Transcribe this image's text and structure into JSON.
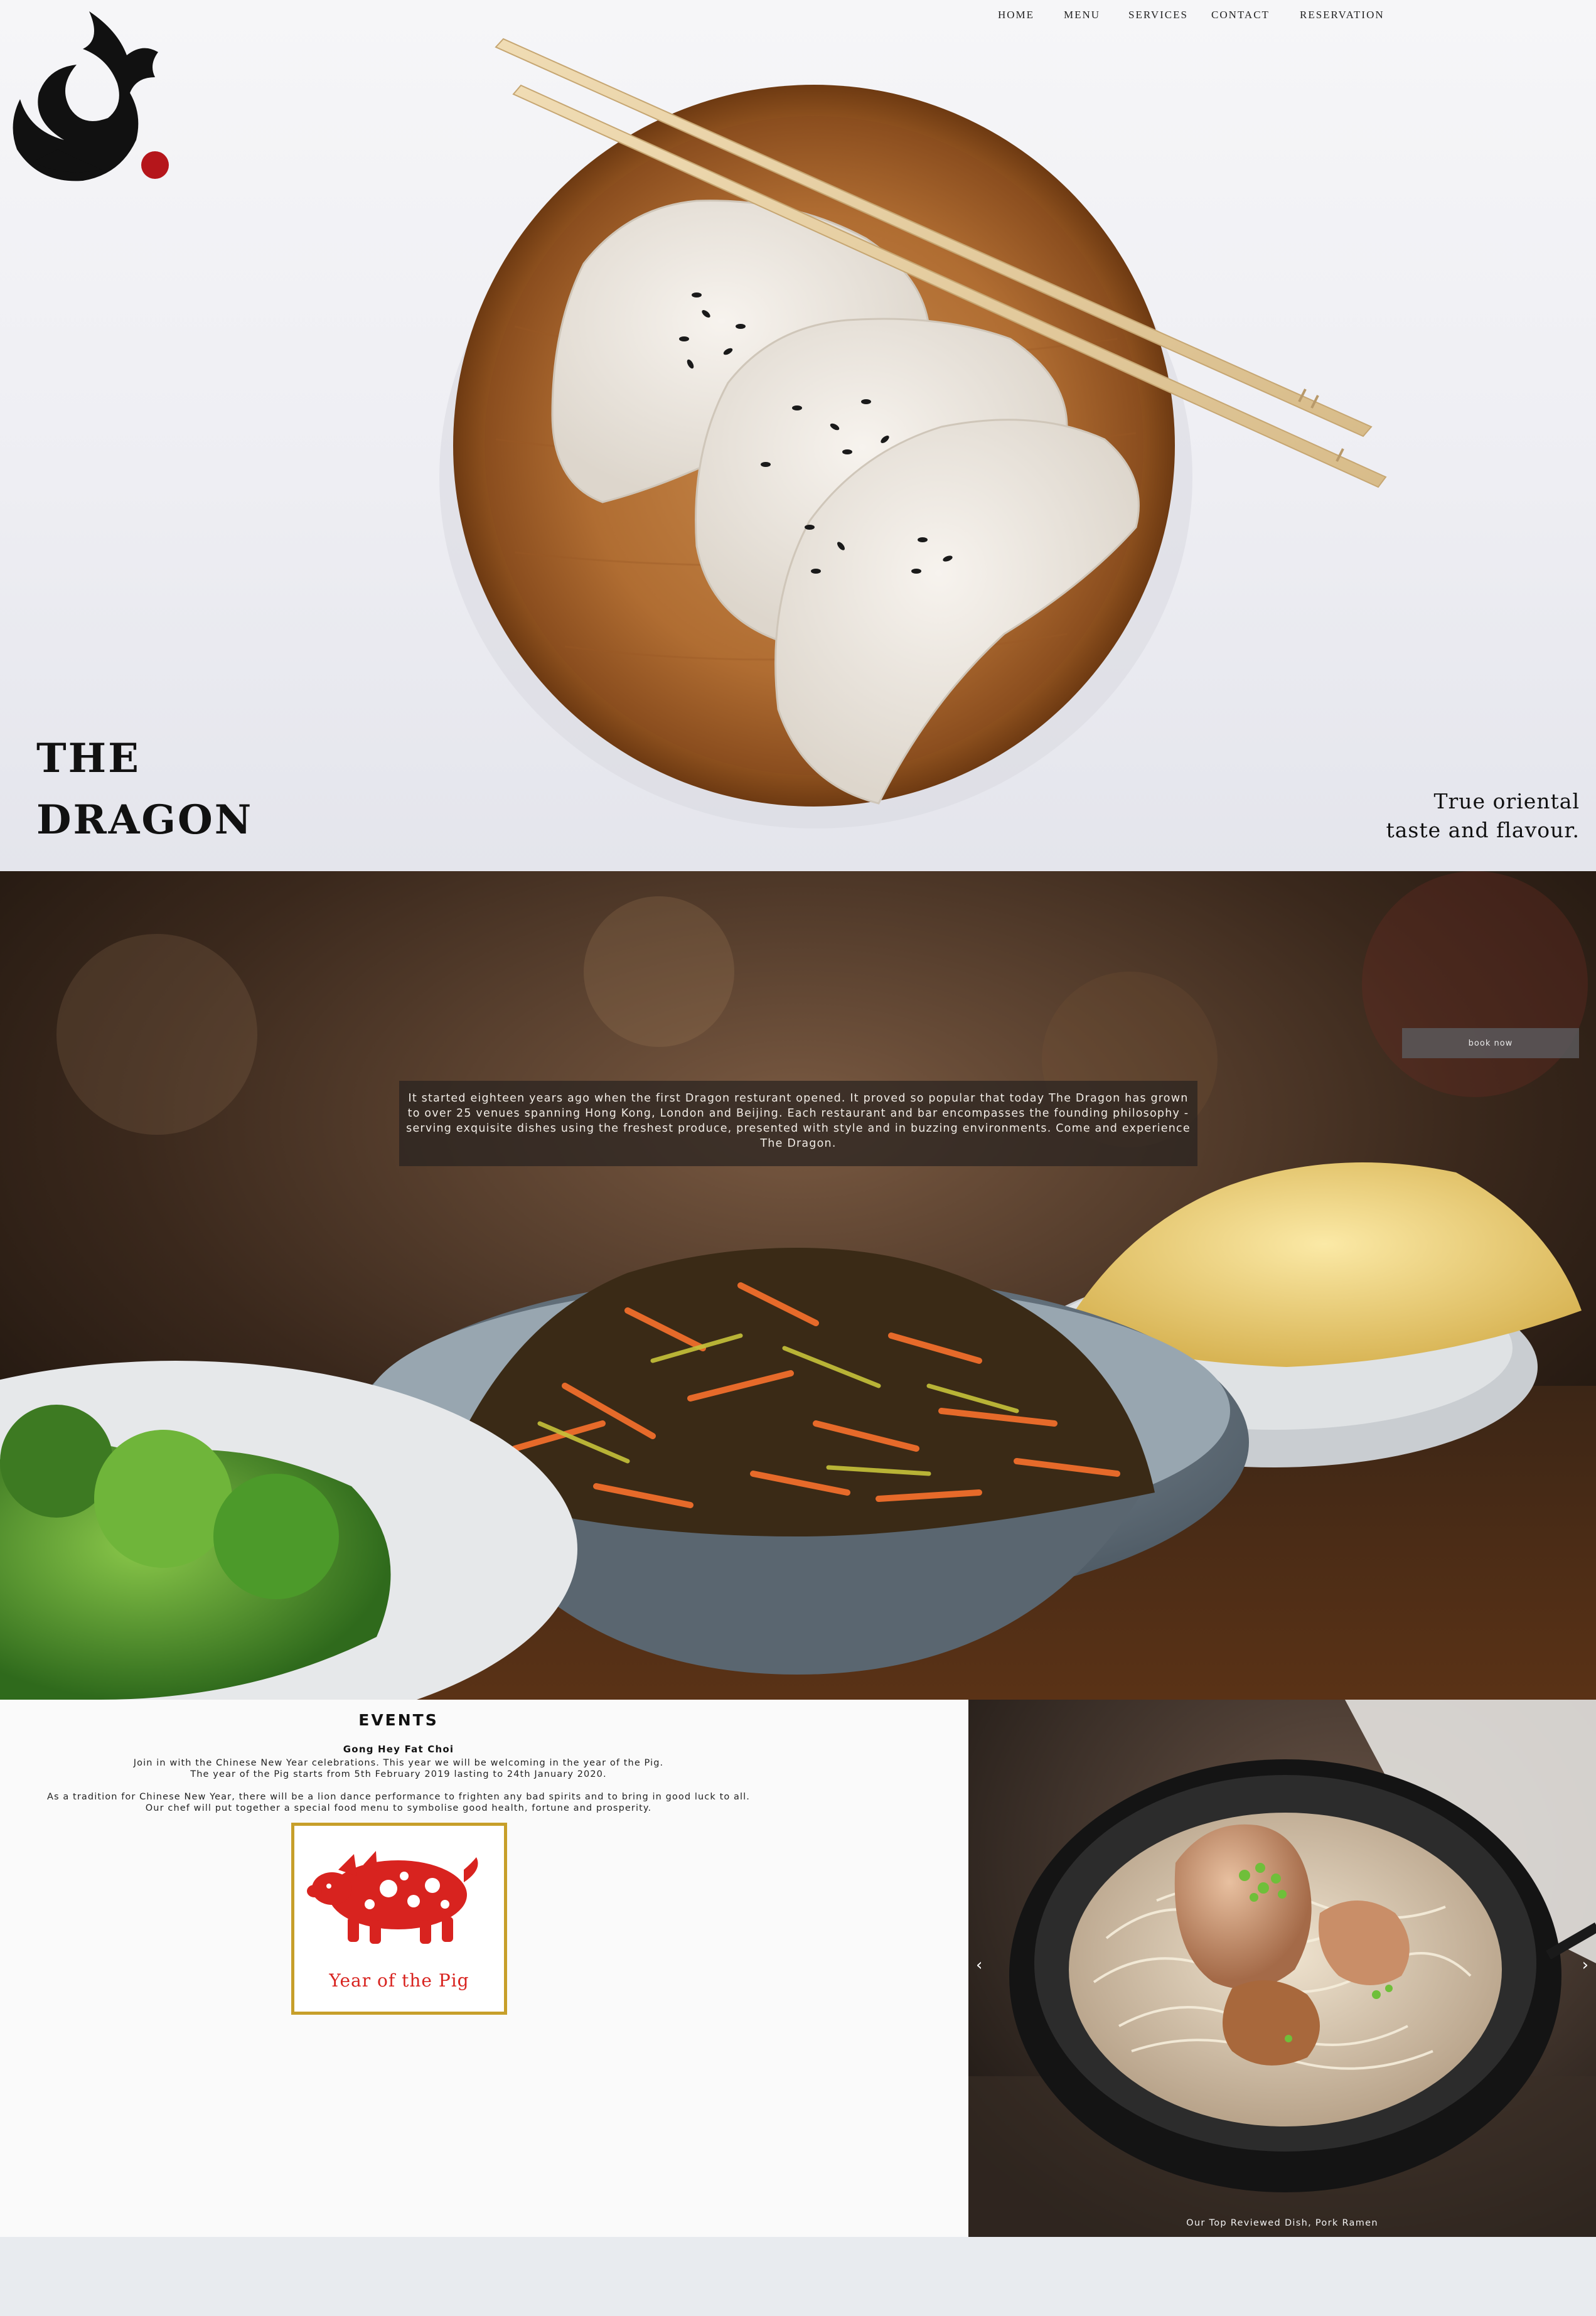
{
  "nav": {
    "items": [
      {
        "label": "HOME"
      },
      {
        "label": "MENU"
      },
      {
        "label": "SERVICES"
      },
      {
        "label": "CONTACT"
      },
      {
        "label": "RESERVATION"
      }
    ]
  },
  "hero": {
    "brand_line1": "THE",
    "brand_line2": "DRAGON",
    "tagline_line1": "True oriental",
    "tagline_line2": "taste and flavour.",
    "logo_icon": "dragon-logo-icon",
    "colors": {
      "logo_dot": "#b5161b",
      "logo_ink": "#111111"
    }
  },
  "about": {
    "text": "It started eighteen years ago when the first Dragon resturant opened. It proved so popular that today The Dragon has grown to over 25 venues spanning Hong Kong, London and Beijing. Each restaurant and bar encompasses the founding philosophy - serving exquisite dishes using the freshest produce, presented with style and in buzzing environments. Come and experience The Dragon.",
    "book_button": "book now"
  },
  "events": {
    "title": "EVENTS",
    "subtitle": "Gong Hey Fat Choi",
    "paragraph1_line1": "Join in with the Chinese New Year celebrations. This year we will be welcoming in the year of the Pig.",
    "paragraph1_line2": "The year of the Pig starts from 5th February 2019 lasting to 24th January 2020.",
    "paragraph2_line1": "As a tradition for Chinese New Year, there will be a lion dance performance to frighten any bad spirits and to bring in good luck to all.",
    "paragraph2_line2": "Our chef will put together a special food menu to symbolise good health, fortune and prosperity.",
    "card_label": "Year of the Pig",
    "colors": {
      "card_border": "#c79f2a",
      "pig_red": "#d8231f"
    }
  },
  "gallery": {
    "caption": "Our Top Reviewed Dish, Pork Ramen",
    "prev_icon": "chevron-left-icon",
    "next_icon": "chevron-right-icon",
    "prev_glyph": "‹",
    "next_glyph": "›"
  }
}
